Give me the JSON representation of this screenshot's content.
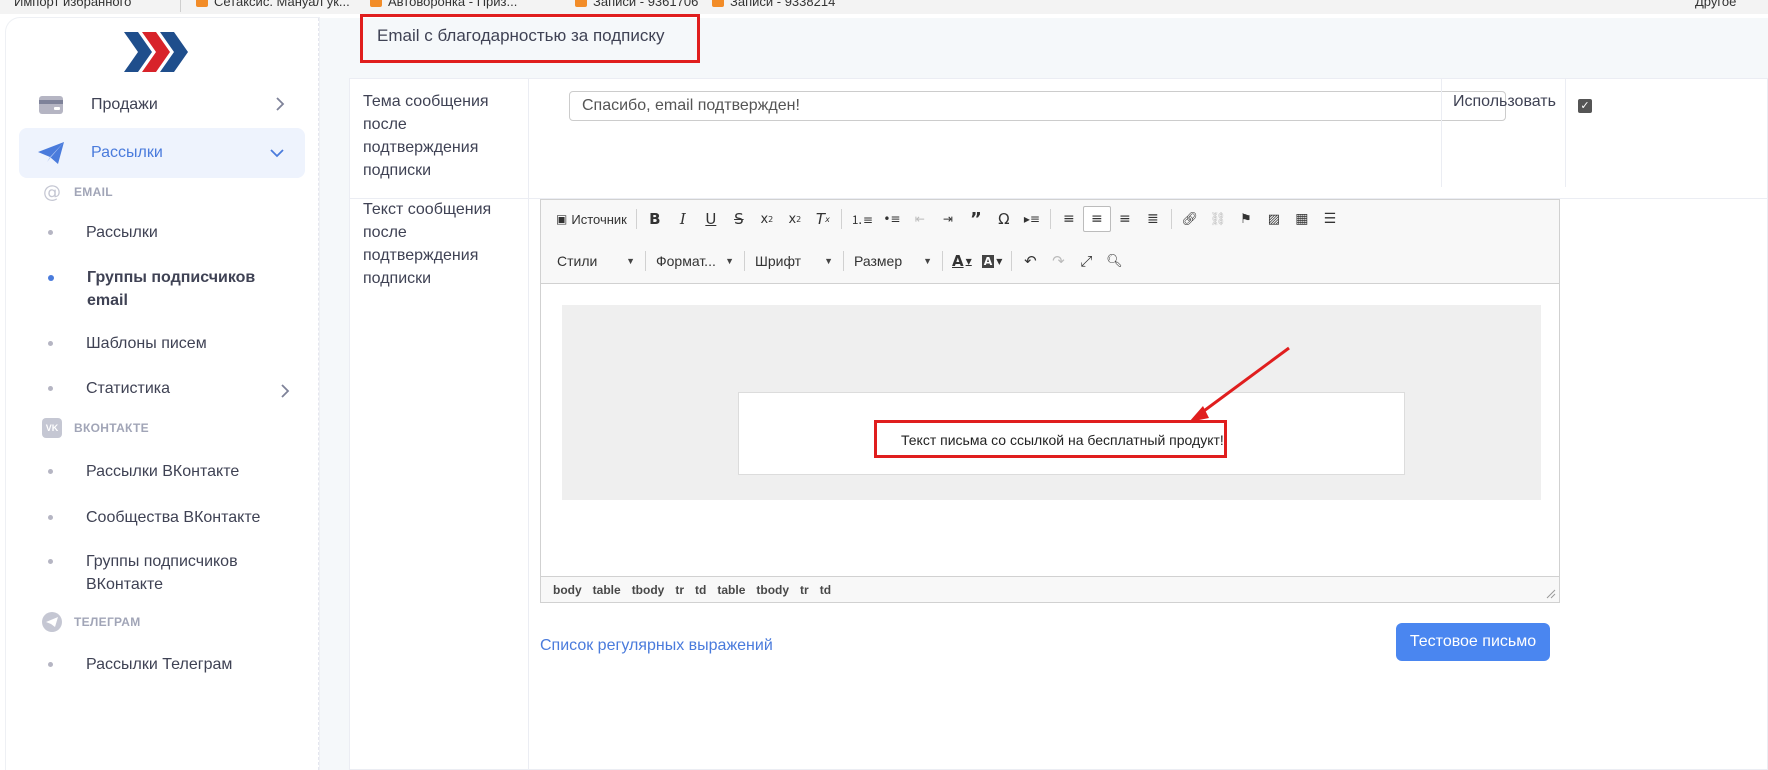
{
  "bookmarks": [
    "Импорт избранного",
    "Сетаксис. Мануал ук...",
    "Автоворонка - Приз...",
    "Записи - 9361706",
    "Записи - 9338214",
    "Другое"
  ],
  "sidebar": {
    "sales": "Продажи",
    "mailings": "Рассылки",
    "sections": {
      "email": "EMAIL",
      "vk": "ВКОНТАКТЕ",
      "telegram": "ТЕЛЕГРАМ"
    },
    "email_items": [
      "Рассылки",
      "Группы подписчиков email",
      "Шаблоны писем",
      "Статистика"
    ],
    "vk_items": [
      "Рассылки ВКонтакте",
      "Сообщества ВКонтакте",
      "Группы подписчиков ВКонтакте"
    ],
    "tg_items": [
      "Рассылки Телеграм"
    ]
  },
  "main": {
    "title": "Email с благодарностью за подписку",
    "subject_label": "Тема сообщения после подтверждения подписки",
    "subject_value": "Спасибо, email подтвержден!",
    "use_label": "Использовать",
    "use_checked": true,
    "body_label": "Текст сообщения после подтверждения подписки",
    "editor": {
      "source": "Источник",
      "styles": "Стили",
      "format": "Формат...",
      "font": "Шрифт",
      "size": "Размер",
      "content_text": "Текст письма со ссылкой на бесплатный продукт!",
      "path": [
        "body",
        "table",
        "tbody",
        "tr",
        "td",
        "table",
        "tbody",
        "tr",
        "td"
      ]
    },
    "regex_link": "Список регулярных выражений",
    "test_button": "Тестовое письмо"
  },
  "colors": {
    "accent": "#4a7bdc",
    "highlight": "#e01e1e",
    "button": "#4a86f0"
  }
}
